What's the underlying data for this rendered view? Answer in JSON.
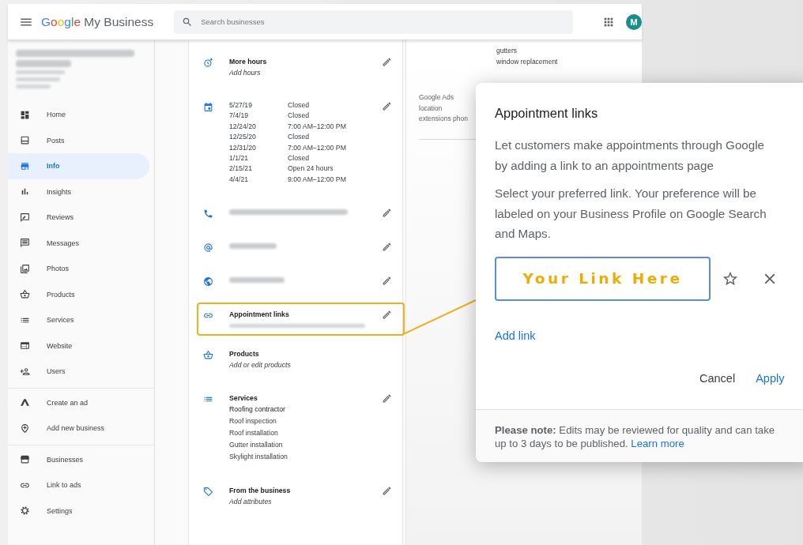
{
  "topbar": {
    "brand": "Google",
    "product": "My Business",
    "search": {
      "placeholder": "Search businesses"
    },
    "avatar": "M"
  },
  "sidebar": {
    "groups": [
      {
        "items": [
          {
            "label": "Home",
            "selected": false
          },
          {
            "label": "Posts",
            "selected": false
          },
          {
            "label": "Info",
            "selected": true
          },
          {
            "label": "Insights",
            "selected": false
          },
          {
            "label": "Reviews",
            "selected": false
          },
          {
            "label": "Messages",
            "selected": false
          },
          {
            "label": "Photos",
            "selected": false
          },
          {
            "label": "Products",
            "selected": false
          },
          {
            "label": "Services",
            "selected": false
          },
          {
            "label": "Website",
            "selected": false
          },
          {
            "label": "Users",
            "selected": false
          }
        ]
      },
      {
        "items": [
          {
            "label": "Create an ad",
            "selected": false
          },
          {
            "label": "Add new business",
            "selected": false
          }
        ]
      },
      {
        "items": [
          {
            "label": "Businesses",
            "selected": false
          },
          {
            "label": "Link to ads",
            "selected": false
          },
          {
            "label": "Settings",
            "selected": false
          }
        ]
      }
    ]
  },
  "info": {
    "items": [
      {
        "kind": "titled",
        "title": "More hours",
        "subtitle": "Add hours",
        "editable": true,
        "highlighted": false
      },
      {
        "kind": "hours",
        "editable": true,
        "highlighted": false,
        "rows": [
          {
            "date": "5/27/19",
            "hours": "Closed"
          },
          {
            "date": "7/4/19",
            "hours": "Closed"
          },
          {
            "date": "12/24/20",
            "hours": "7:00 AM–12:00 PM"
          },
          {
            "date": "12/25/20",
            "hours": "Closed"
          },
          {
            "date": "12/31/20",
            "hours": "7:00 AM–12:00 PM"
          },
          {
            "date": "1/1/21",
            "hours": "Closed"
          },
          {
            "date": "2/15/21",
            "hours": "Open 24 hours"
          },
          {
            "date": "4/4/21",
            "hours": "9:00 AM–12:00 PM"
          }
        ]
      },
      {
        "kind": "blurred",
        "editable": true,
        "highlighted": false
      },
      {
        "kind": "blurred",
        "editable": true,
        "highlighted": false
      },
      {
        "kind": "blurred",
        "editable": true,
        "highlighted": false
      },
      {
        "kind": "titled-blurred",
        "title": "Appointment links",
        "editable": true,
        "highlighted": true
      },
      {
        "kind": "titled",
        "title": "Products",
        "subtitle": "Add or edit products",
        "editable": false,
        "highlighted": false
      },
      {
        "kind": "list",
        "title": "Services",
        "lines": [
          "Roofing contractor",
          "Roof inspection",
          "Roof installation",
          "Gutter installation",
          "Skylight installation"
        ],
        "editable": true,
        "highlighted": false
      },
      {
        "kind": "titled",
        "title": "From the business",
        "subtitle": "Add attributes",
        "editable": true,
        "highlighted": false
      }
    ]
  },
  "details": {
    "lines": [
      "gutters",
      "window replacement"
    ],
    "ads_lines": [
      "Google Ads",
      "location",
      "extensions phon"
    ]
  },
  "dialog": {
    "title": "Appointment links",
    "paragraphs": [
      "Let customers make appointments through Google by adding a link to an appointments page",
      "Select your preferred link. Your preference will be labeled on your Business Profile on Google Search and Maps."
    ],
    "link_field": {
      "value": "Your Link Here"
    },
    "add_link": "Add link",
    "buttons": [
      {
        "label": "Cancel",
        "kind": "text"
      },
      {
        "label": "Apply",
        "kind": "primary"
      }
    ],
    "note": "**Please note:** Edits may be reviewed for quality and can take up to 3 days to be published.",
    "learn_more": "Learn more"
  }
}
